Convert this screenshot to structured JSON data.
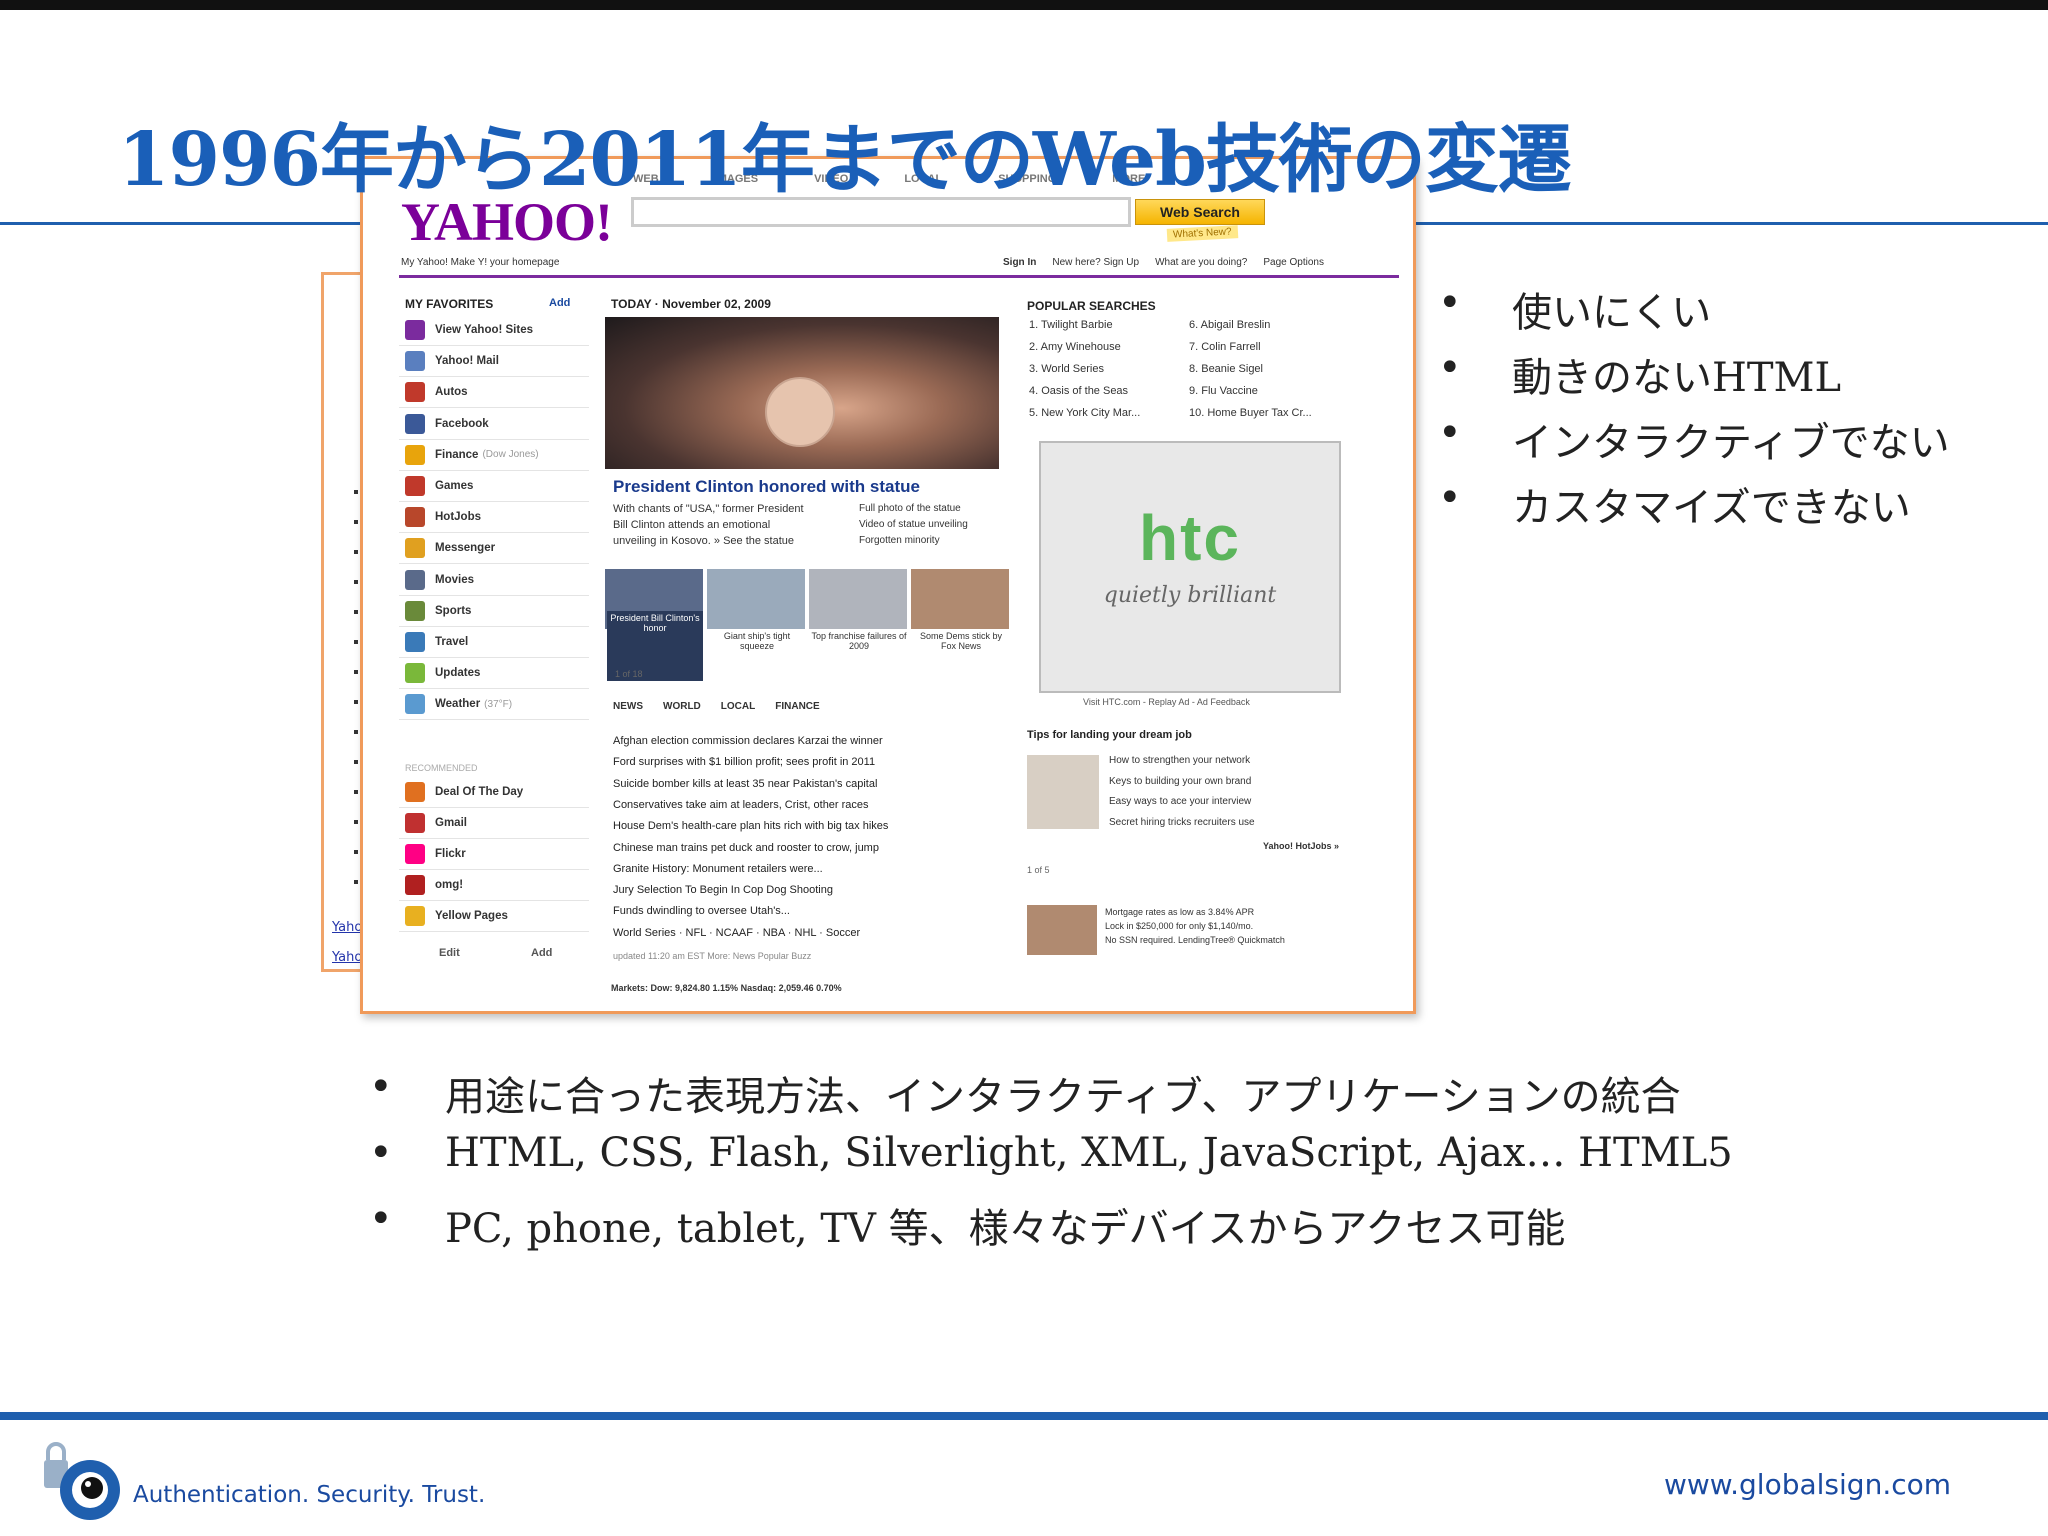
{
  "slide": {
    "title": "1996年から2011年までのWeb技術の変遷",
    "right_bullets": [
      "使いにくい",
      "動きのないHTML",
      "インタラクティブでない",
      "カスタマイズできない"
    ],
    "bottom_bullets": [
      "用途に合った表現方法、インタラクティブ、アプリケーションの統合",
      "HTML, CSS, Flash, Silverlight, XML, JavaScript, Ajax… HTML5",
      "PC, phone, tablet, TV 等、様々なデバイスからアクセス可能"
    ],
    "bullet_marker": "•",
    "back_links": [
      "Yaho",
      "Yaho"
    ]
  },
  "footer": {
    "tagline": "Authentication. Security. Trust.",
    "url": "www.globalsign.com"
  },
  "yahoo": {
    "logo": "YAHOO!",
    "tabs": [
      "WEB",
      "IMAGES",
      "VIDEO",
      "LOCAL",
      "SHOPPING",
      "MORE"
    ],
    "search_button": "Web Search",
    "whats_new": "What's New?",
    "sub_left": "My Yahoo!   Make Y! your homepage",
    "sub_right": [
      "Sign In",
      "New here? Sign Up",
      "What are you doing?",
      "Page Options"
    ],
    "favorites_title": "MY FAVORITES",
    "add_label": "Add",
    "favorites": [
      {
        "label": "View Yahoo! Sites",
        "sub": "",
        "color": "#7b2b9e"
      },
      {
        "label": "Yahoo! Mail",
        "sub": "",
        "color": "#5a7fbf"
      },
      {
        "label": "Autos",
        "sub": "",
        "color": "#c0392b"
      },
      {
        "label": "Facebook",
        "sub": "",
        "color": "#3b5998"
      },
      {
        "label": "Finance",
        "sub": "(Dow Jones)",
        "color": "#e8a40c"
      },
      {
        "label": "Games",
        "sub": "",
        "color": "#c0392b"
      },
      {
        "label": "HotJobs",
        "sub": "",
        "color": "#b8472b"
      },
      {
        "label": "Messenger",
        "sub": "",
        "color": "#e0a020"
      },
      {
        "label": "Movies",
        "sub": "",
        "color": "#5a6a8a"
      },
      {
        "label": "Sports",
        "sub": "",
        "color": "#6a8a3a"
      },
      {
        "label": "Travel",
        "sub": "",
        "color": "#3a7ab8"
      },
      {
        "label": "Updates",
        "sub": "",
        "color": "#7ab83a"
      },
      {
        "label": "Weather",
        "sub": "(37°F)",
        "color": "#5a9ad0"
      }
    ],
    "recommended_title": "RECOMMENDED",
    "recommended": [
      {
        "label": "Deal Of The Day",
        "color": "#e07020"
      },
      {
        "label": "Gmail",
        "color": "#c03030"
      },
      {
        "label": "Flickr",
        "color": "#ff0084"
      },
      {
        "label": "omg!",
        "color": "#b02020"
      },
      {
        "label": "Yellow Pages",
        "color": "#e8b020"
      }
    ],
    "edit_label": "Edit",
    "add2_label": "Add",
    "today_title": "TODAY · November 02, 2009",
    "headline": "President Clinton honored with statue",
    "story": [
      "With chants of \"USA,\" former President",
      "Bill Clinton attends an emotional",
      "unveiling in Kosovo.  » See the statue"
    ],
    "story_links": [
      "Full photo of the statue",
      "Video of statue unveiling",
      "Forgotten minority"
    ],
    "thumbs": [
      "President Bill Clinton's honor",
      "Giant ship's tight squeeze",
      "Top franchise failures of 2009",
      "Some Dems stick by Fox News"
    ],
    "pager": "1 of 18",
    "news_tabs": [
      "NEWS",
      "WORLD",
      "LOCAL",
      "FINANCE"
    ],
    "news": [
      "Afghan election commission declares Karzai the winner",
      "Ford surprises with $1 billion profit; sees profit in 2011",
      "Suicide bomber kills at least 35 near Pakistan's capital",
      "Conservatives take aim at leaders, Crist, other races",
      "House Dem's health-care plan hits rich with big tax hikes",
      "Chinese man trains pet duck and rooster to crow, jump",
      "Granite History: Monument retailers were...",
      "Jury Selection To Begin In Cop Dog Shooting",
      "Funds dwindling to oversee Utah's...",
      "World Series · NFL · NCAAF · NBA · NHL · Soccer"
    ],
    "news_footer": "updated 11:20 am EST          More: News  Popular  Buzz",
    "markets": "Markets: Dow: 9,824.80 1.15%  Nasdaq: 2,059.46 0.70%",
    "popular_title": "POPULAR SEARCHES",
    "popular": [
      "1. Twilight Barbie",
      "2. Amy Winehouse",
      "3. World Series",
      "4. Oasis of the Seas",
      "5. New York City Mar...",
      "6. Abigail Breslin",
      "7. Colin Farrell",
      "8. Beanie Sigel",
      "9. Flu Vaccine",
      "10. Home Buyer Tax Cr..."
    ],
    "ad_logo": "htc",
    "ad_tagline": "quietly brilliant",
    "ad_caption": "Visit HTC.com - Replay Ad - Ad Feedback",
    "tips_title": "Tips for landing your dream job",
    "tips": [
      "How to strengthen your network",
      "Keys to building your own brand",
      "Easy ways to ace your interview",
      "Secret hiring tricks recruiters use"
    ],
    "tips_source": "Yahoo! HotJobs »",
    "tips_pager": "1 of 5",
    "mortgage": [
      "Mortgage rates as low as 3.84% APR",
      "Lock in $250,000 for only $1,140/mo.",
      "No SSN required. LendingTree® Quickmatch"
    ]
  }
}
